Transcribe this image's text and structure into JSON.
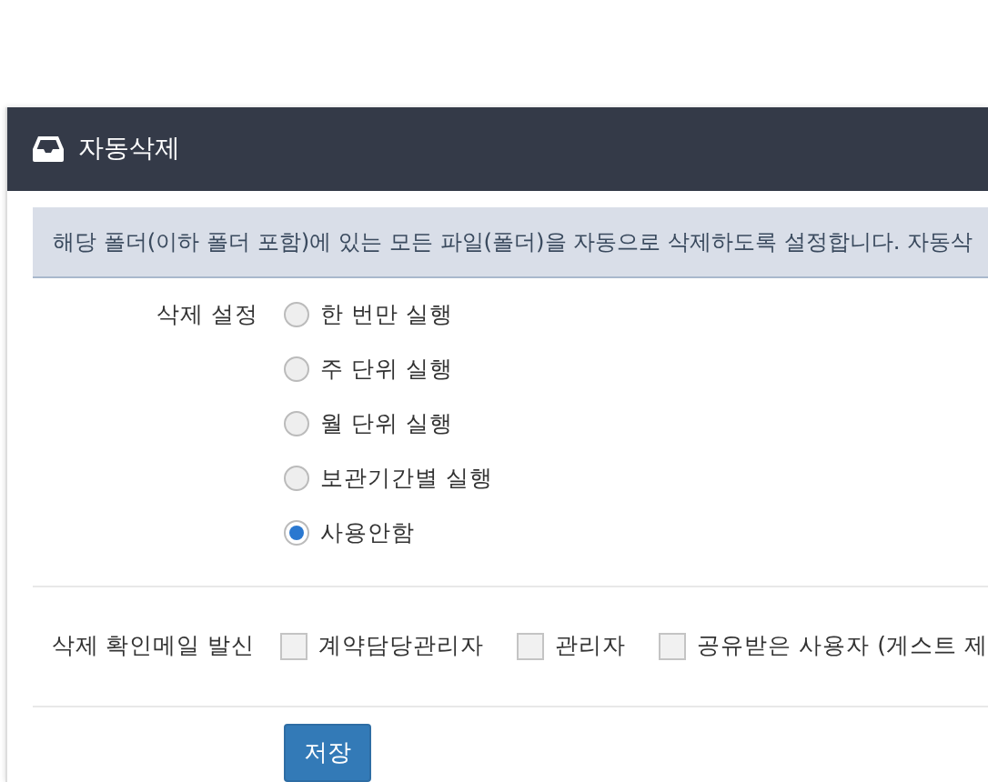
{
  "window": {
    "title": "자동삭제"
  },
  "notice": "해당 폴더(이하 폴더 포함)에 있는 모든 파일(폴더)을 자동으로 삭제하도록 설정합니다. 자동삭",
  "delete_setting": {
    "label": "삭제 설정",
    "options": [
      {
        "label": "한 번만 실행",
        "selected": false
      },
      {
        "label": "주 단위 실행",
        "selected": false
      },
      {
        "label": "월 단위 실행",
        "selected": false
      },
      {
        "label": "보관기간별 실행",
        "selected": false
      },
      {
        "label": "사용안함",
        "selected": true
      }
    ]
  },
  "confirm_mail": {
    "label": "삭제 확인메일 발신",
    "options": [
      {
        "label": "계약담당관리자",
        "checked": false
      },
      {
        "label": "관리자",
        "checked": false
      },
      {
        "label": "공유받은 사용자 (게스트 제",
        "checked": false
      }
    ]
  },
  "buttons": [
    "저장"
  ]
}
